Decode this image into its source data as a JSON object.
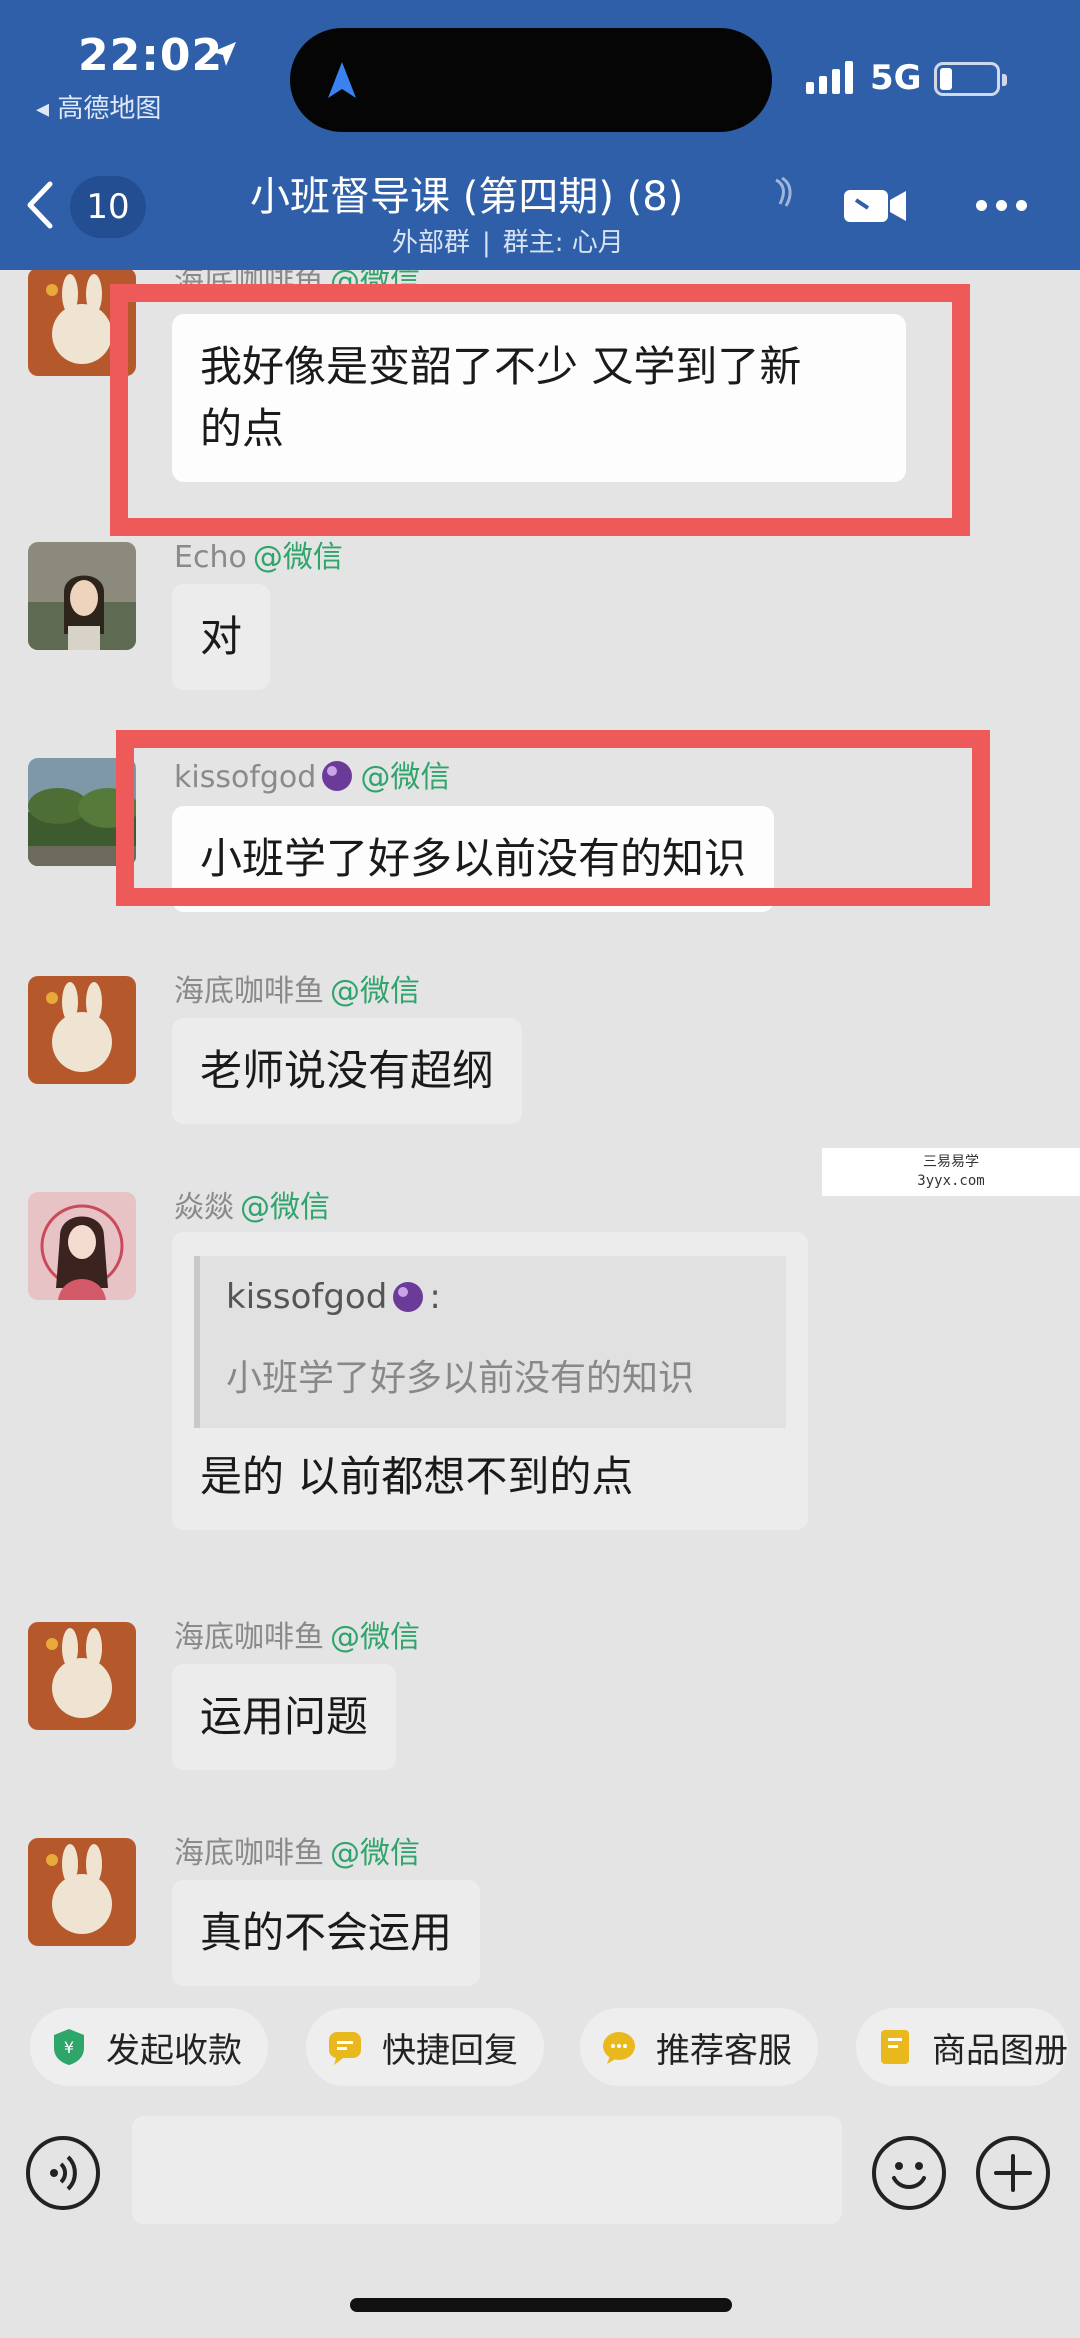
{
  "status": {
    "time": "22:02",
    "back_app": "◂ 高德地图",
    "network": "5G"
  },
  "header": {
    "unread_count": "10",
    "title": "小班督导课 (第四期) (8)",
    "subtitle_type": "外部群",
    "subtitle_owner": "群主: 心月"
  },
  "messages": [
    {
      "sender": "海底咖啡鱼",
      "source": "@微信",
      "text_lines": [
        "我好像是变韶了不少 又学到了新",
        "的点"
      ]
    },
    {
      "sender": "Echo",
      "source": "@微信",
      "text": "对"
    },
    {
      "sender": "kissofgod",
      "source": "@微信",
      "text": "小班学了好多以前没有的知识"
    },
    {
      "sender": "海底咖啡鱼",
      "source": "@微信",
      "text": "老师说没有超纲"
    },
    {
      "sender": "焱燚",
      "source": "@微信",
      "quote_name": "kissofgod",
      "quote_suffix": ":",
      "quote_text": "小班学了好多以前没有的知识",
      "text": "是的 以前都想不到的点"
    },
    {
      "sender": "海底咖啡鱼",
      "source": "@微信",
      "text": "运用问题"
    },
    {
      "sender": "海底咖啡鱼",
      "source": "@微信",
      "text": "真的不会运用"
    }
  ],
  "watermark": {
    "line1": "三易易学",
    "line2": "3yyx.com"
  },
  "quick_actions": [
    {
      "label": "发起收款",
      "icon": "payment-icon",
      "color": "#2ea66a"
    },
    {
      "label": "快捷回复",
      "icon": "quick-reply-icon",
      "color": "#e8b81c"
    },
    {
      "label": "推荐客服",
      "icon": "service-icon",
      "color": "#e8b81c"
    },
    {
      "label": "商品图册",
      "icon": "catalog-icon",
      "color": "#e8b81c"
    }
  ],
  "colors": {
    "header_bg": "#2f5fa8",
    "highlight": "#ee5a5a",
    "wechat_tag": "#2fa46b"
  }
}
